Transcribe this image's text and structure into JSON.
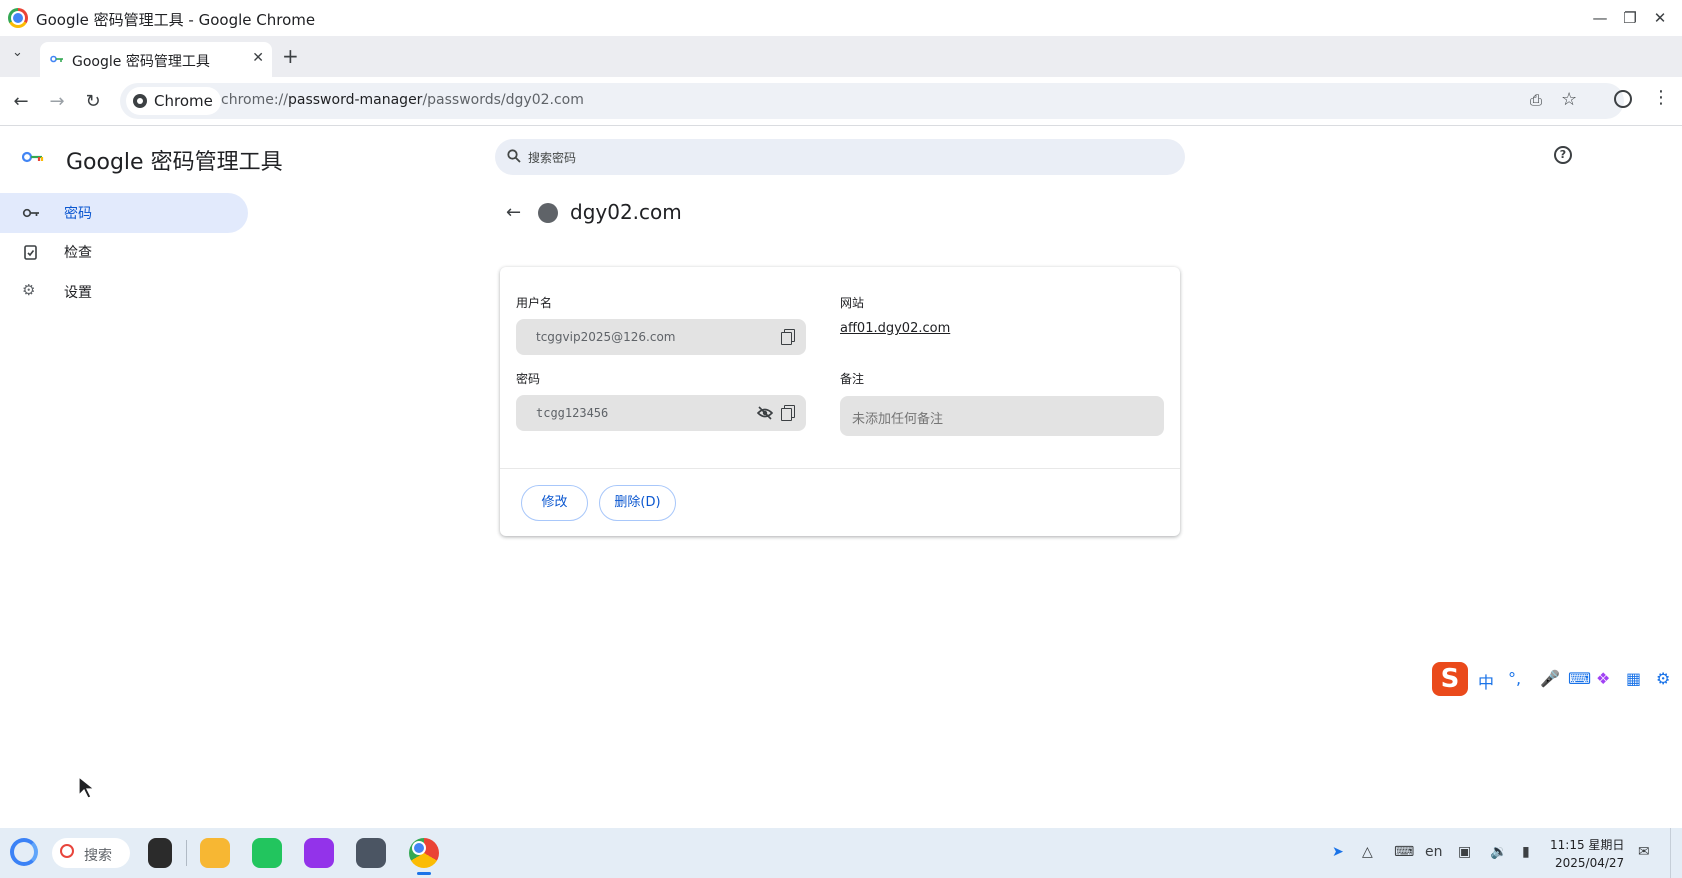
{
  "window": {
    "title": "Google 密码管理工具 - Google Chrome",
    "controls": [
      "minimize",
      "restore",
      "close"
    ]
  },
  "tabs": [
    {
      "label": "Google 密码管理工具",
      "active": true
    }
  ],
  "toolbar": {
    "chip_label": "Chrome",
    "url_scheme": "chrome://",
    "url_host": "password-manager",
    "url_path": "/passwords/dgy02.com"
  },
  "app": {
    "title": "Google 密码管理工具",
    "search_placeholder": "搜索密码"
  },
  "sidebar": {
    "items": [
      {
        "label": "密码",
        "icon": "key-icon",
        "active": true
      },
      {
        "label": "检查",
        "icon": "checkup-icon",
        "active": false
      },
      {
        "label": "设置",
        "icon": "gear-icon",
        "active": false
      }
    ]
  },
  "detail": {
    "site": "dgy02.com",
    "username_label": "用户名",
    "username_value": "tcggvip2025@126.com",
    "password_label": "密码",
    "password_value": "tcgg123456",
    "website_label": "网站",
    "website_value": "aff01.dgy02.com",
    "note_label": "备注",
    "note_placeholder": "未添加任何备注",
    "edit_button": "修改",
    "delete_button": "删除(D)"
  },
  "ime": {
    "logo": "S",
    "mode": "中",
    "punct": "°,"
  },
  "taskbar": {
    "search_label": "搜索",
    "tray_lang": "en",
    "time": "11:15 星期日",
    "date": "2025/04/27"
  },
  "colors": {
    "accent": "#0b57d0",
    "active_nav_bg": "#e2eafc",
    "field_bg": "#e3e3e3",
    "taskbar_bg": "#e4edf6"
  }
}
